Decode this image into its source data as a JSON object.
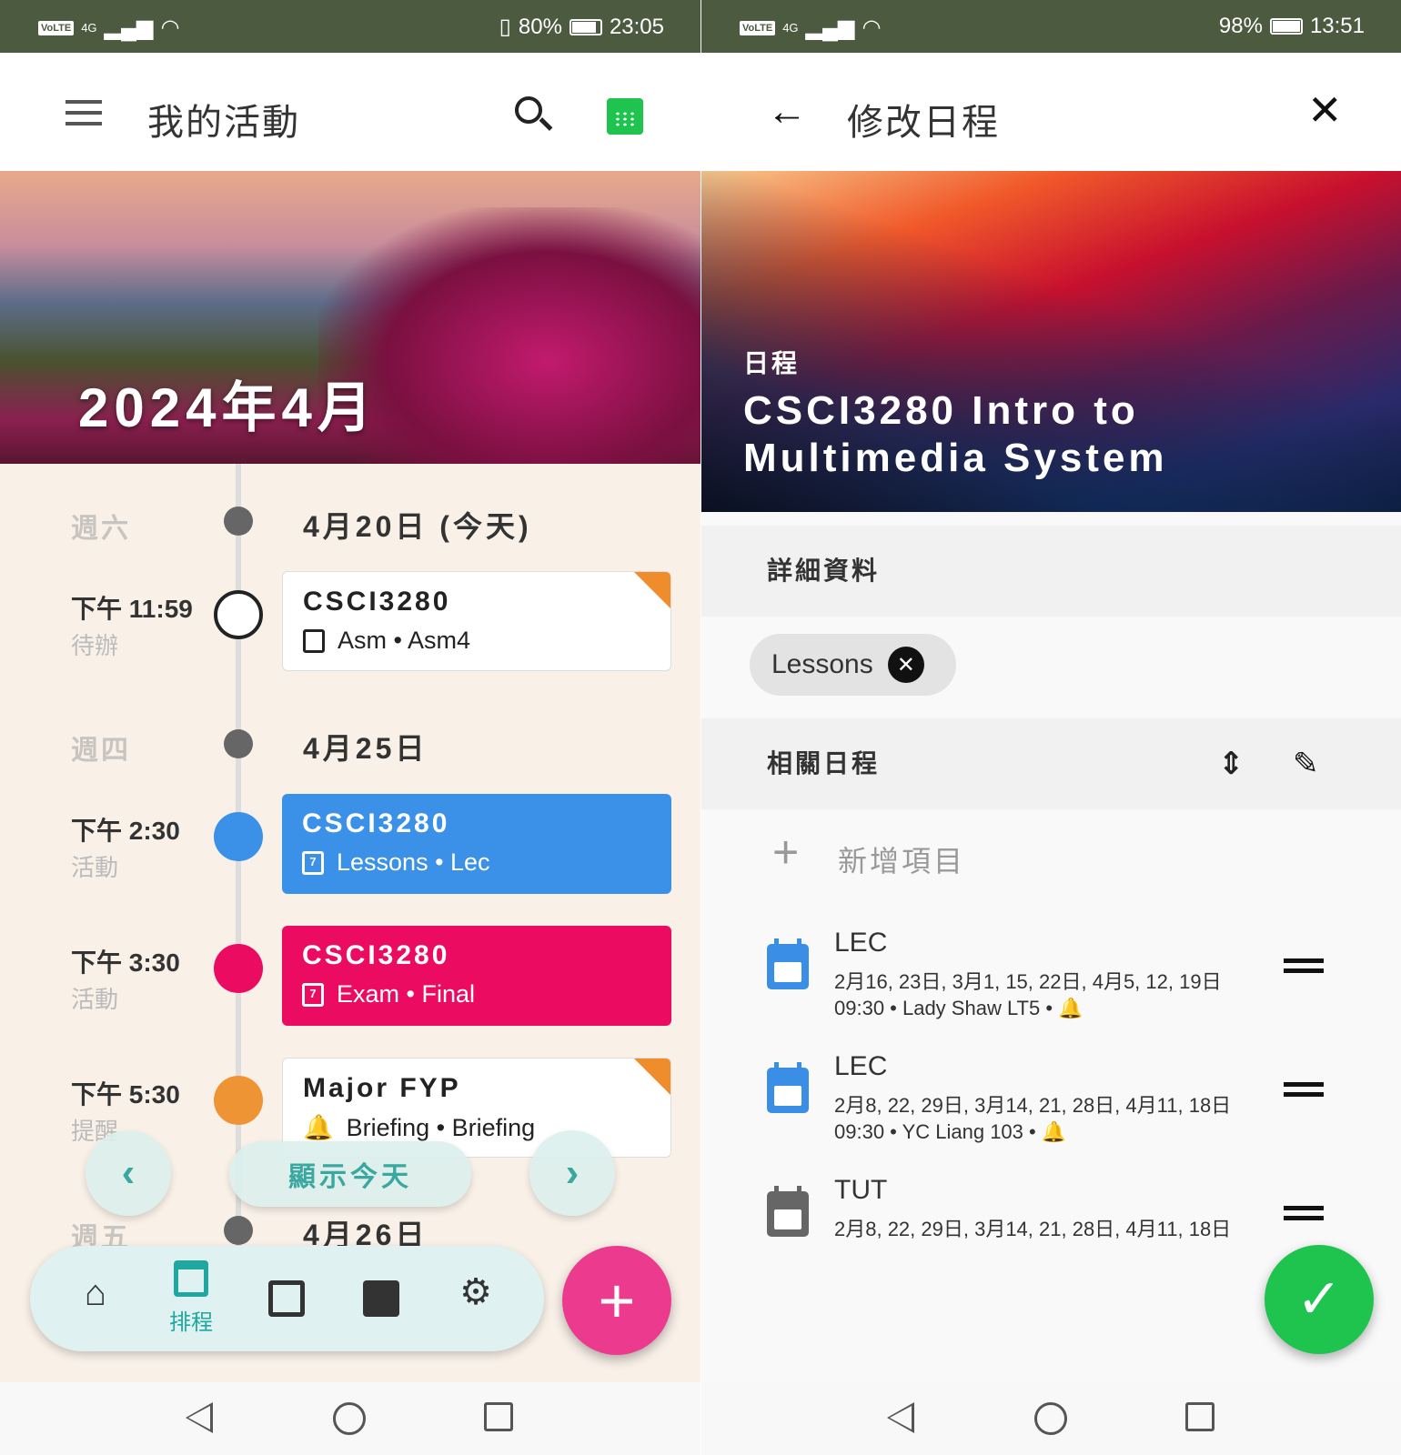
{
  "left": {
    "status": {
      "network": "4G",
      "battery": "80%",
      "time": "23:05"
    },
    "appbar": {
      "title": "我的活動",
      "menu_icon": "menu-icon",
      "search_icon": "search-icon",
      "calendar_icon": "calendar-icon"
    },
    "hero": {
      "month": "2024年4月"
    },
    "timeline": [
      {
        "weekday": "週六",
        "date": "4月20日 (今天)"
      },
      {
        "weekday": "週四",
        "date": "4月25日"
      },
      {
        "weekday": "週五",
        "date": "4月26日"
      }
    ],
    "events": [
      {
        "time": "下午 11:59",
        "type": "待辦",
        "title": "CSCI3280",
        "detail": "Asm • Asm4",
        "color": "#ffffff"
      },
      {
        "time": "下午 2:30",
        "type": "活動",
        "title": "CSCI3280",
        "detail": "Lessons • Lec",
        "color": "#3b91e8"
      },
      {
        "time": "下午 3:30",
        "type": "活動",
        "title": "CSCI3280",
        "detail": "Exam • Final",
        "color": "#eb0c62"
      },
      {
        "time": "下午 5:30",
        "type": "提醒",
        "title": "Major FYP",
        "detail": "Briefing • Briefing",
        "color": "#ffffff"
      }
    ],
    "controls": {
      "prev": "‹",
      "today": "顯示今天",
      "next": "›"
    },
    "bottom_nav": {
      "active_label": "排程"
    },
    "fab": "+"
  },
  "right": {
    "status": {
      "network": "4G",
      "battery": "98%",
      "time": "13:51"
    },
    "appbar": {
      "title": "修改日程"
    },
    "hero": {
      "kind": "日程",
      "title_line1": "CSCI3280 Intro to",
      "title_line2": "Multimedia System"
    },
    "details_header": "詳細資料",
    "chip": "Lessons",
    "related_header": "相關日程",
    "add_item": "新增項目",
    "items": [
      {
        "name": "LEC",
        "dates": "2月16, 23日, 3月1, 15, 22日, 4月5, 12, 19日",
        "info": "09:30 • Lady Shaw LT5 •",
        "color": "#3b8ee6"
      },
      {
        "name": "LEC",
        "dates": "2月8, 22, 29日, 3月14, 21, 28日, 4月11, 18日",
        "info": "09:30 • YC Liang 103 •",
        "color": "#3b8ee6"
      },
      {
        "name": "TUT",
        "dates": "2月8, 22, 29日, 3月14, 21, 28日, 4月11, 18日",
        "info": "",
        "color": "#666666"
      }
    ]
  }
}
